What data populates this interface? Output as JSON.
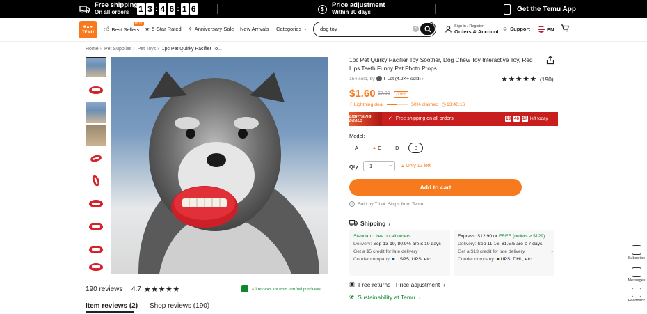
{
  "promo": {
    "shipping_title": "Free shipping",
    "shipping_sub": "On all orders",
    "countdown": [
      "1",
      "3",
      "4",
      "6",
      "1",
      "6"
    ],
    "price_title": "Price adjustment",
    "price_sub": "Within 30 days",
    "app_label": "Get the Temu App"
  },
  "nav": {
    "logo_text": "TEMU",
    "hot_badge": "HOT",
    "best_sellers": "Best Sellers",
    "five_star": "5-Star Rated",
    "anniversary": "Anniversary Sale",
    "new_arrivals": "New Arrivals",
    "categories": "Categories",
    "search_value": "dog toy",
    "signin_small": "Sign in / Register",
    "signin_big": "Orders & Account",
    "support": "Support",
    "language": "EN"
  },
  "breadcrumb": [
    "Home",
    "Pet Supplies",
    "Pet Toys",
    "1pc Pet Quirky Pacifier To..."
  ],
  "product": {
    "title": "1pc Pet Quirky Pacifier Toy Soother, Dog Chew Toy Interactive Toy, Red Lips Teeth Funny Pet Photo Props",
    "sold": "154 sold, by",
    "store": "T Lot (4.2K+ sold)",
    "rating_count": "(190)",
    "rating": 4.7,
    "price": "$1.60",
    "old_price": "$7.99",
    "discount": "-79%",
    "lightning": "Lightning deal",
    "claimed": "50% claimed",
    "claimed_fraction": 0.5,
    "deal_timer": "13:46:16",
    "lightning_badge": "LIGHTNING DEALS",
    "free_shipping_bar": "Free shipping on all orders",
    "timer_parts": [
      "13",
      "46",
      "17"
    ],
    "timer_suffix": "left today",
    "model_label": "Model:",
    "models": [
      "A",
      "C",
      "D",
      "B"
    ],
    "selected_model": "B",
    "qty_label": "Qty :",
    "qty_value": "1",
    "stock_left": "Only 13 left",
    "add_to_cart": "Add to cart",
    "sold_by": "Sold by T Lot. Ships from Temu."
  },
  "shipping": {
    "heading": "Shipping",
    "standard_label": "Standard:",
    "standard_value": "free on all orders",
    "standard_delivery_label": "Delivery:",
    "standard_delivery": "Sep 13-19, 80.9% are ≤ 10 days",
    "standard_credit": "Get a $5 credit for late delivery",
    "standard_courier_label": "Courier company:",
    "standard_couriers": "USPS, UPS, etc.",
    "express_label": "Express: $12.90 or",
    "express_free": "FREE (orders ≥ $129)",
    "express_delivery_label": "Delivery:",
    "express_delivery": "Sep 11-16, 81.5% are ≤ 7 days",
    "express_credit": "Get a $13 credit for late delivery",
    "express_courier_label": "Courier company:",
    "express_couriers": "UPS, DHL, etc."
  },
  "returns": "Free returns · Price adjustment",
  "sustainability": "Sustainability at Temu",
  "reviews": {
    "count": "190 reviews",
    "score": "4.7",
    "verified": "All reviews are from verified purchases",
    "tab_item": "Item reviews (2)",
    "tab_shop": "Shop reviews (190)"
  },
  "side": {
    "subscribe": "Subscribe",
    "messages": "Messages",
    "feedback": "Feedback"
  },
  "colors": {
    "accent": "#f77b1e",
    "deal_red": "#c81e1e",
    "verified_green": "#0a8a2c"
  }
}
